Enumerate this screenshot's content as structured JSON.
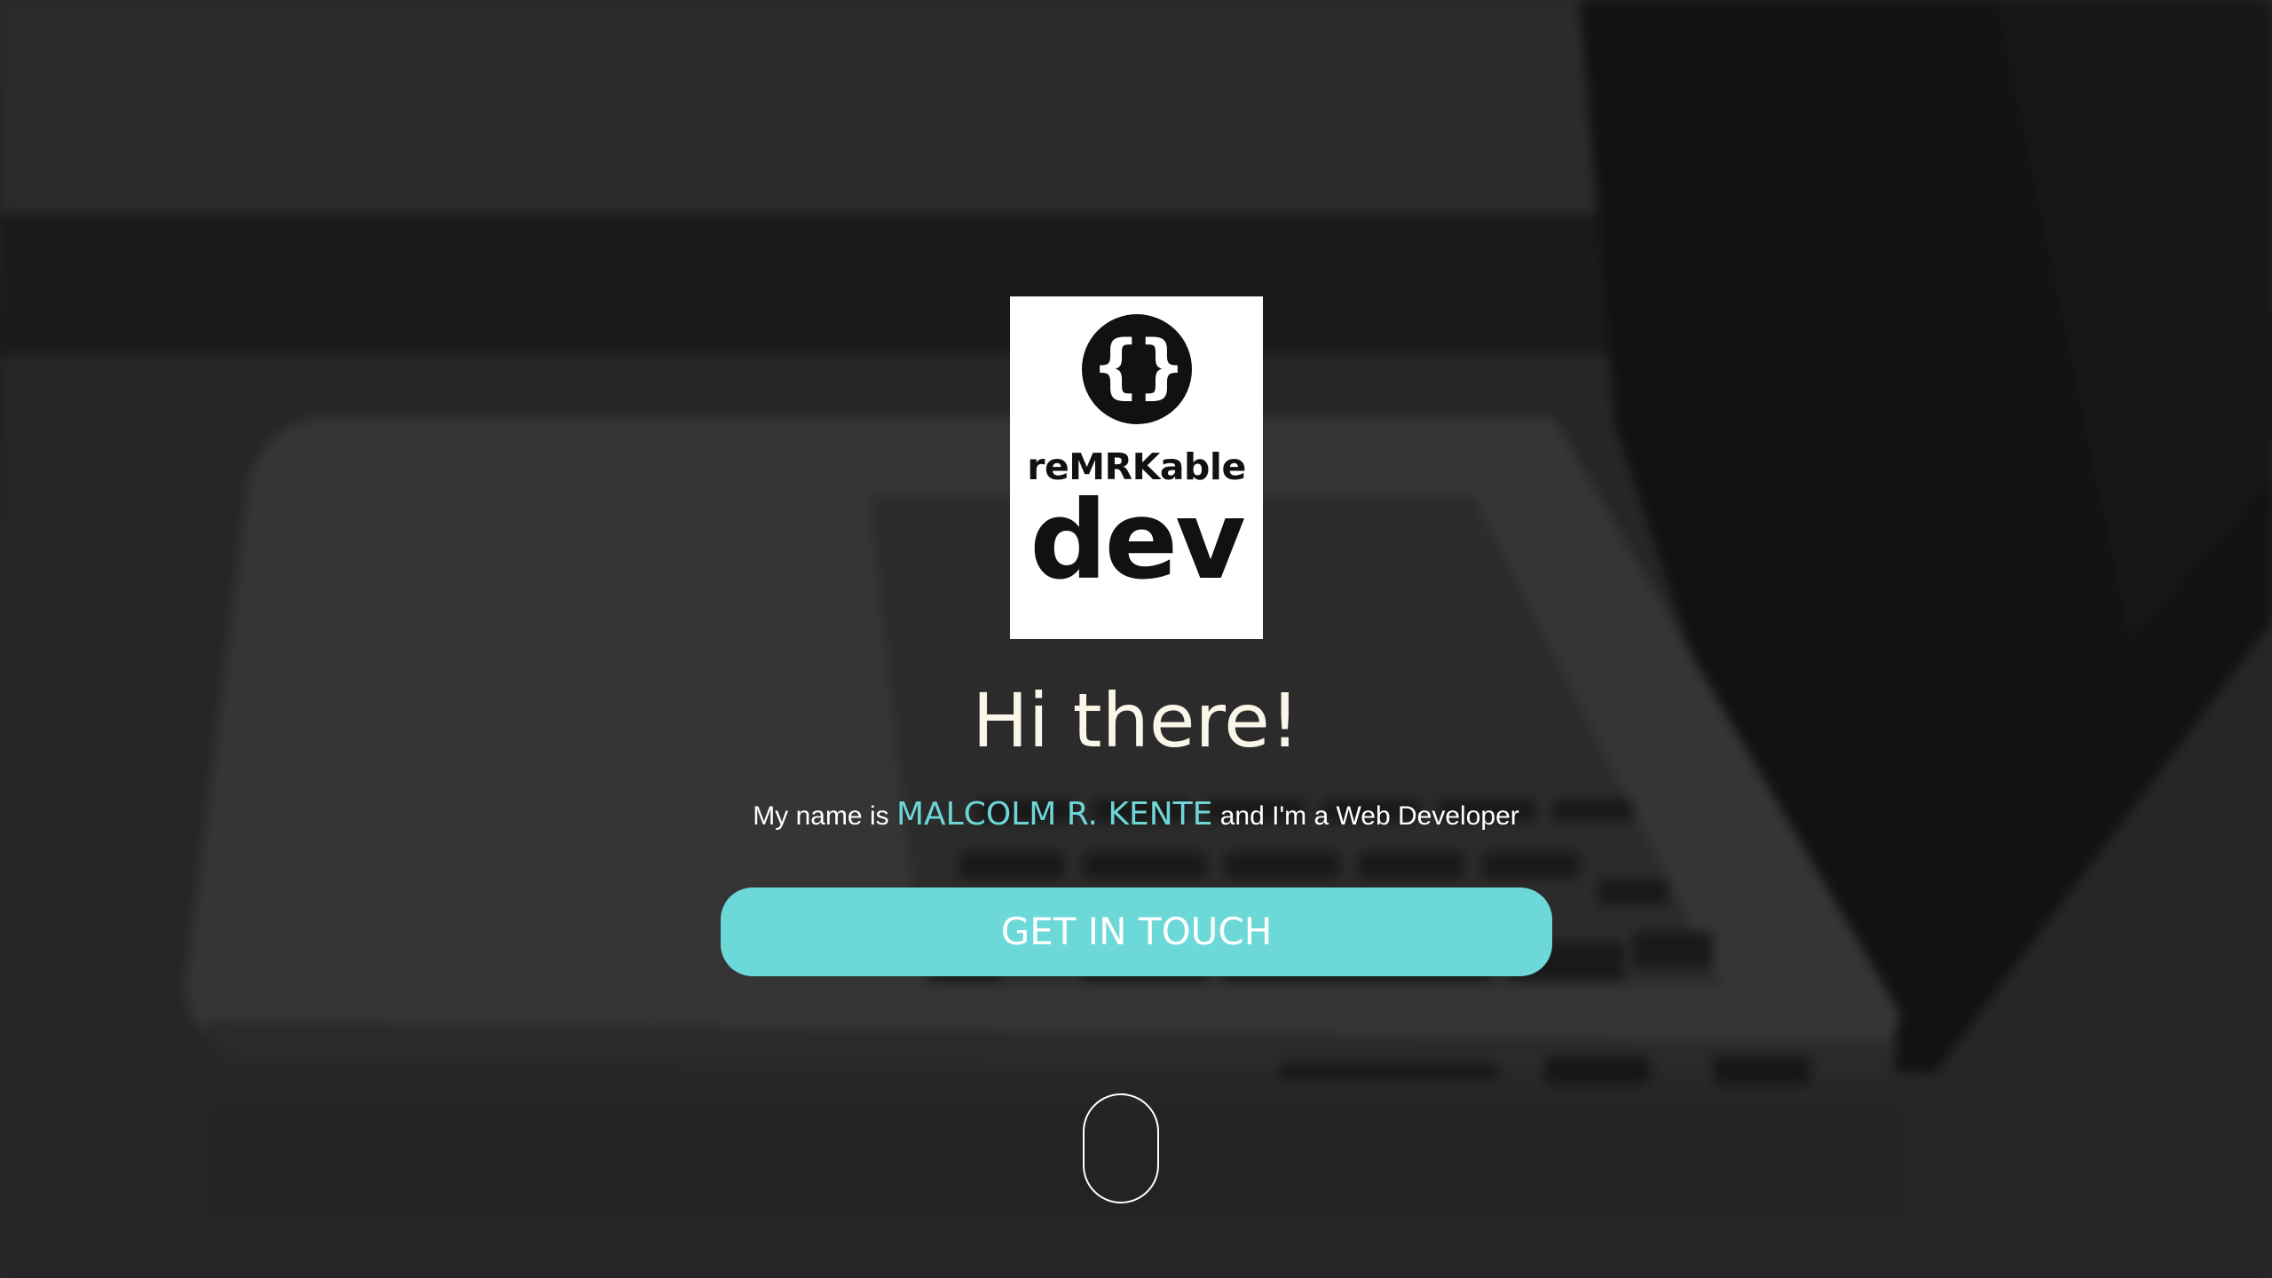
{
  "logo": {
    "icon": "curly-braces-icon",
    "braces_glyph": "{}",
    "line1": "reMRKable",
    "line2": "dev"
  },
  "hero": {
    "greeting": "Hi there!",
    "intro_prefix": "My name is ",
    "name": "MALCOLM R. KENTE",
    "intro_suffix": " and I'm a Web Developer",
    "cta_label": "GET IN TOUCH",
    "scroll_icon": "mouse-scroll-icon"
  },
  "colors": {
    "accent": "#6dd8d8",
    "name_highlight": "#6ed6d6",
    "greeting_text": "#fbf7e8",
    "background": "#232323"
  }
}
